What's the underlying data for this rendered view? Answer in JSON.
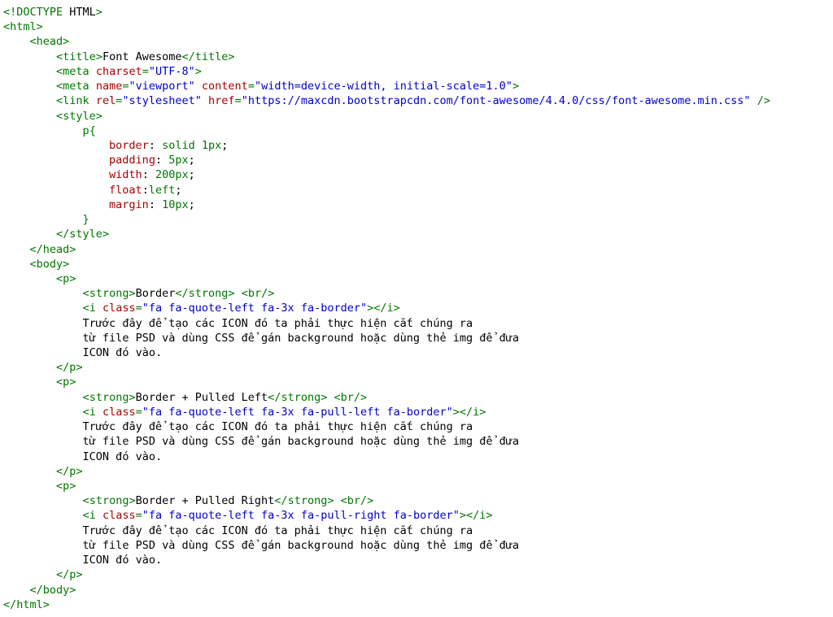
{
  "html_decl": "HTML",
  "tags": {
    "html": "html",
    "head": "head",
    "title": "title",
    "meta": "meta",
    "link": "link",
    "style": "style",
    "body": "body",
    "p": "p",
    "strong": "strong",
    "br": "br",
    "i": "i"
  },
  "attrs": {
    "charset": "charset",
    "name": "name",
    "content": "content",
    "rel": "rel",
    "href": "href",
    "class": "class"
  },
  "vals": {
    "utf8": "\"UTF-8\"",
    "viewport": "\"viewport\"",
    "viewport_content": "\"width=device-width, initial-scale=1.0\"",
    "stylesheet": "\"stylesheet\"",
    "fa_url": "\"https://maxcdn.bootstrapcdn.com/font-awesome/4.4.0/css/font-awesome.min.css\"",
    "i1": "\"fa fa-quote-left fa-3x fa-border\"",
    "i2": "\"fa fa-quote-left fa-3x fa-pull-left fa-border\"",
    "i3": "\"fa fa-quote-left fa-3x fa-pull-right fa-border\""
  },
  "title_text": "Font Awesome",
  "css": {
    "selector": "p",
    "p_border_k": "border",
    "p_border_v": "solid 1px",
    "p_padding_k": "padding",
    "p_padding_v": "5px",
    "p_width_k": "width",
    "p_width_v": "200px",
    "p_float_k": "float",
    "p_float_v": "left",
    "p_margin_k": "margin",
    "p_margin_v": "10px"
  },
  "sections": {
    "s1_title": "Border",
    "s2_title": "Border + Pulled Left",
    "s3_title": "Border + Pulled Right",
    "paragraph_l1": "Trước đây để tạo các ICON đó ta phải thực hiện cắt chúng ra",
    "paragraph_l2": "từ file PSD và dùng CSS để gán background hoặc dùng thẻ img để đưa",
    "paragraph_l3": "ICON đó vào."
  }
}
